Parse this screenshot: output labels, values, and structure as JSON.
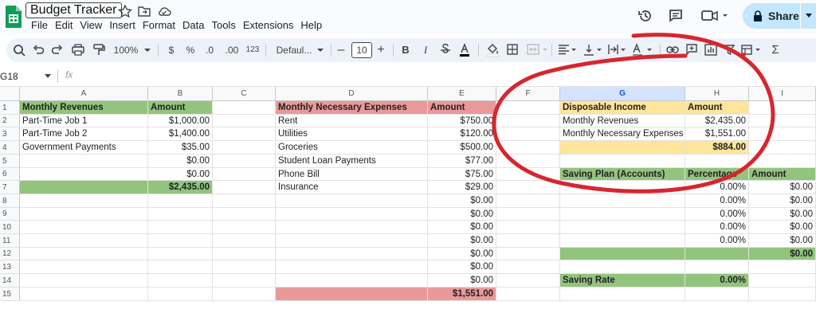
{
  "app": {
    "title": "Budget Tracker",
    "menus": [
      "File",
      "Edit",
      "View",
      "Insert",
      "Format",
      "Data",
      "Tools",
      "Extensions",
      "Help"
    ],
    "share_label": "Share"
  },
  "toolbar": {
    "zoom": "100%",
    "currency": "$",
    "percent": "%",
    "dec_less": ".0",
    "dec_more": ".00",
    "number_format": "123",
    "font": "Defaul...",
    "font_size": "10",
    "bold": "B",
    "italic": "I"
  },
  "formula_bar": {
    "cell_ref": "G18",
    "fx": "fx"
  },
  "columns": [
    "A",
    "B",
    "C",
    "D",
    "E",
    "F",
    "G",
    "H",
    "I"
  ],
  "rows": [
    "1",
    "2",
    "3",
    "4",
    "5",
    "6",
    "7",
    "8",
    "9",
    "10",
    "11",
    "12",
    "13",
    "14",
    "15"
  ],
  "table_a": {
    "header": "Monthly Revenues",
    "amount_header": "Amount",
    "labels": [
      "Part-Time Job 1",
      "Part-Time Job 2",
      "Government Payments",
      "",
      ""
    ],
    "amounts": [
      "$1,000.00",
      "$1,400.00",
      "$35.00",
      "$0.00",
      "$0.00"
    ],
    "total": "$2,435.00"
  },
  "table_d": {
    "header": "Monthly Necessary Expenses",
    "amount_header": "Amount",
    "labels": [
      "Rent",
      "Utilities",
      "Groceries",
      "Student Loan Payments",
      "Phone Bill",
      "Insurance",
      "",
      "",
      "",
      "",
      "",
      "",
      ""
    ],
    "amounts": [
      "$750.00",
      "$120.00",
      "$500.00",
      "$77.00",
      "$75.00",
      "$29.00",
      "$0.00",
      "$0.00",
      "$0.00",
      "$0.00",
      "$0.00",
      "$0.00",
      "$0.00"
    ],
    "total": "$1,551.00"
  },
  "disposable": {
    "header": "Disposable Income",
    "amount_header": "Amount",
    "revenues_label": "Monthly Revenues",
    "revenues": "$2,435.00",
    "expenses_label": "Monthly Necessary Expenses",
    "expenses": "$1,551.00",
    "total": "$884.00"
  },
  "saving_plan": {
    "header": "Saving Plan (Accounts)",
    "percentage_header": "Percentage",
    "amount_header": "Amount",
    "percentages": [
      "0.00%",
      "0.00%",
      "0.00%",
      "0.00%",
      "0.00%"
    ],
    "amounts": [
      "$0.00",
      "$0.00",
      "$0.00",
      "$0.00",
      "$0.00"
    ],
    "total": "$0.00",
    "rate_label": "Saving Rate",
    "rate": "0.00%"
  },
  "colors": {
    "green": "#93c47d",
    "red": "#ea9999",
    "yellow": "#ffe599",
    "annotation": "#d7262e"
  }
}
